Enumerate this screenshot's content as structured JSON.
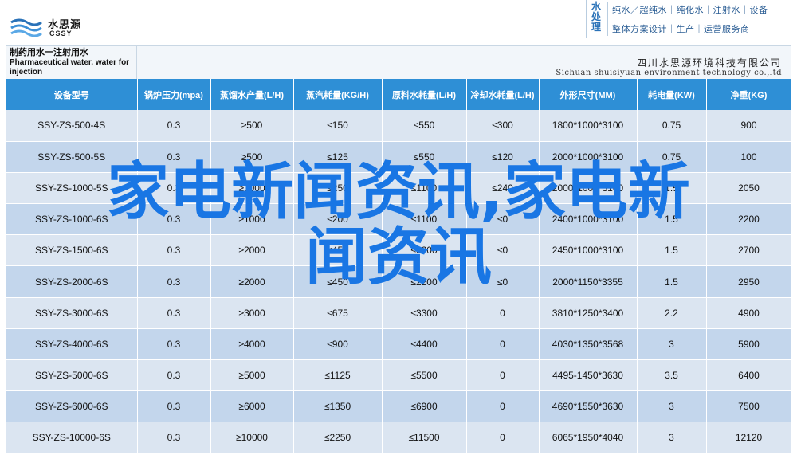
{
  "brand": {
    "logo_cn": "水思源",
    "logo_en": "CSSY",
    "badge": "水处理",
    "tagline_1": "纯水／超纯水｜纯化水｜注射水｜设备",
    "tagline_2": "整体方案设计｜生产｜运营服务商"
  },
  "strip": {
    "model_cn": "制药用水一注射用水",
    "model_en": "Pharmaceutical water, water for injection",
    "company_cn": "四川水思源环境科技有限公司",
    "company_en": "Sichuan shuisiyuan environment technology co.,ltd"
  },
  "table": {
    "headers": [
      "设备型号",
      "锅炉压力(mpa)",
      "蒸馏水产量(L/H)",
      "蒸汽耗量(KG/H)",
      "原料水耗量(L/H)",
      "冷却水耗量(L/H)",
      "外形尺寸(MM)",
      "耗电量(KW)",
      "净重(KG)"
    ],
    "rows": [
      [
        "SSY-ZS-500-4S",
        "0.3",
        "≥500",
        "≤150",
        "≤550",
        "≤300",
        "1800*1000*3100",
        "0.75",
        "900"
      ],
      [
        "SSY-ZS-500-5S",
        "0.3",
        "≥500",
        "≤125",
        "≤550",
        "≤120",
        "2000*1000*3100",
        "0.75",
        "100"
      ],
      [
        "SSY-ZS-1000-5S",
        "0.3",
        "≥1000",
        "≤250",
        "≤1100",
        "≤240",
        "2000*1000*3100",
        "1.5",
        "2050"
      ],
      [
        "SSY-ZS-1000-6S",
        "0.3",
        "≥1000",
        "≤200",
        "≤1100",
        "≤0",
        "2400*1000*3100",
        "1.5",
        "2200"
      ],
      [
        "SSY-ZS-1500-6S",
        "0.3",
        "≥2000",
        "≤450",
        "≤2200",
        "≤0",
        "2450*1000*3100",
        "1.5",
        "2700"
      ],
      [
        "SSY-ZS-2000-6S",
        "0.3",
        "≥2000",
        "≤450",
        "≤2200",
        "≤0",
        "2000*1150*3355",
        "1.5",
        "2950"
      ],
      [
        "SSY-ZS-3000-6S",
        "0.3",
        "≥3000",
        "≤675",
        "≤3300",
        "0",
        "3810*1250*3400",
        "2.2",
        "4900"
      ],
      [
        "SSY-ZS-4000-6S",
        "0.3",
        "≥4000",
        "≤900",
        "≤4400",
        "0",
        "4030*1350*3568",
        "3",
        "5900"
      ],
      [
        "SSY-ZS-5000-6S",
        "0.3",
        "≥5000",
        "≤1125",
        "≤5500",
        "0",
        "4495-1450*3630",
        "3.5",
        "6400"
      ],
      [
        "SSY-ZS-6000-6S",
        "0.3",
        "≥6000",
        "≤1350",
        "≤6900",
        "0",
        "4690*1550*3630",
        "3",
        "7500"
      ],
      [
        "SSY-ZS-10000-6S",
        "0.3",
        "≥10000",
        "≤2250",
        "≤11500",
        "0",
        "6065*1950*4040",
        "3",
        "12120"
      ]
    ]
  },
  "overlay": {
    "line_1": "家电新闻资讯,家电新",
    "line_2": "闻资讯"
  },
  "colors": {
    "header_bg": "#2e8fd6",
    "row_light": "#dbe5f1",
    "row_dark": "#c3d6ec",
    "overlay_text": "#1976e4"
  }
}
